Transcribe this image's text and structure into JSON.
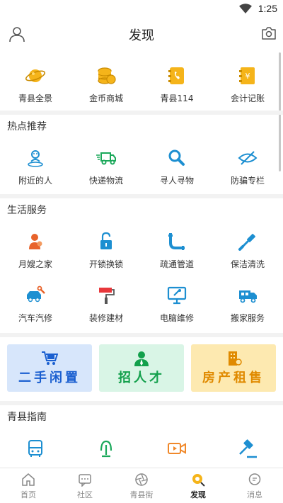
{
  "status": {
    "time": "1:25"
  },
  "header": {
    "title": "发现"
  },
  "top_grid": [
    {
      "label": "青县全景",
      "icon": "planet-icon"
    },
    {
      "label": "金币商城",
      "icon": "coins-icon"
    },
    {
      "label": "青县114",
      "icon": "phone-book-icon"
    },
    {
      "label": "会计记账",
      "icon": "ledger-icon"
    }
  ],
  "hot": {
    "title": "热点推荐",
    "items": [
      {
        "label": "附近的人",
        "icon": "nearby-person-icon"
      },
      {
        "label": "快递物流",
        "icon": "delivery-truck-icon"
      },
      {
        "label": "寻人寻物",
        "icon": "search-icon"
      },
      {
        "label": "防骗专栏",
        "icon": "eye-slash-icon"
      }
    ]
  },
  "life": {
    "title": "生活服务",
    "row1": [
      {
        "label": "月嫂之家",
        "icon": "nanny-icon"
      },
      {
        "label": "开锁换锁",
        "icon": "unlock-icon"
      },
      {
        "label": "疏通管道",
        "icon": "pipe-icon"
      },
      {
        "label": "保洁清洗",
        "icon": "brush-icon"
      }
    ],
    "row2": [
      {
        "label": "汽车汽修",
        "icon": "car-repair-icon"
      },
      {
        "label": "装修建材",
        "icon": "paint-roller-icon"
      },
      {
        "label": "电脑维修",
        "icon": "monitor-repair-icon"
      },
      {
        "label": "搬家服务",
        "icon": "moving-truck-icon"
      }
    ]
  },
  "banners": [
    {
      "text": "二手闲置",
      "icon": "cart-icon"
    },
    {
      "text": "招人才",
      "icon": "recruit-icon"
    },
    {
      "text": "房产租售",
      "icon": "building-icon"
    }
  ],
  "guide": {
    "title": "青县指南",
    "items": [
      {
        "label": "",
        "icon": "bus-icon"
      },
      {
        "label": "",
        "icon": "train-icon"
      },
      {
        "label": "",
        "icon": "video-icon"
      },
      {
        "label": "",
        "icon": "gavel-icon"
      }
    ]
  },
  "tabs": [
    {
      "label": "首页",
      "icon": "home-icon",
      "active": false
    },
    {
      "label": "社区",
      "icon": "chat-icon",
      "active": false
    },
    {
      "label": "青县街",
      "icon": "aperture-icon",
      "active": false
    },
    {
      "label": "发现",
      "icon": "discover-icon",
      "active": true
    },
    {
      "label": "消息",
      "icon": "message-icon",
      "active": false
    }
  ],
  "colors": {
    "yellow_icon": "#f5b41a",
    "blue_icon": "#1d8fd1",
    "active_tab": "#f5b41a"
  }
}
